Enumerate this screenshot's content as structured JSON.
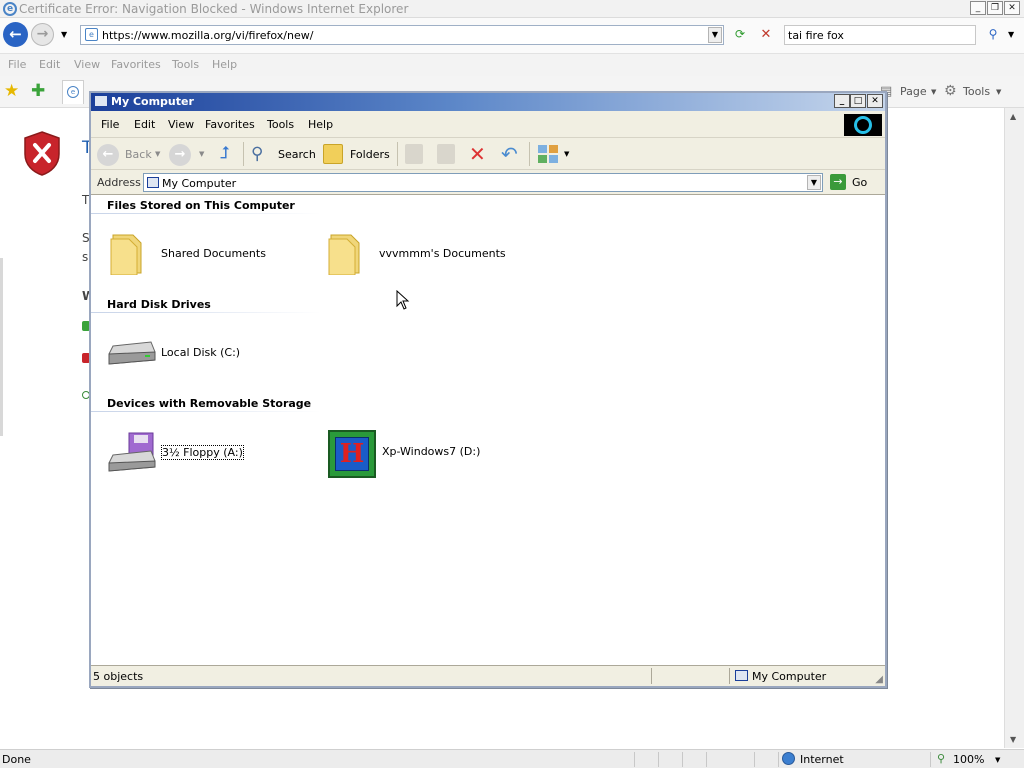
{
  "ie": {
    "title": "Certificate Error: Navigation Blocked - Windows Internet Explorer",
    "url": "https://www.mozilla.org/vi/firefox/new/",
    "search_value": "tai fire fox",
    "menu": [
      "File",
      "Edit",
      "View",
      "Favorites",
      "Tools",
      "Help"
    ],
    "cmd_page": "Page",
    "cmd_tools": "Tools",
    "page_fragments": [
      "T",
      "T",
      "S",
      "s",
      "W"
    ],
    "status": {
      "text": "Done",
      "zone": "Internet",
      "zoom": "100%"
    }
  },
  "mc": {
    "title": "My Computer",
    "menu": [
      "File",
      "Edit",
      "View",
      "Favorites",
      "Tools",
      "Help"
    ],
    "toolbar": {
      "back": "Back",
      "search": "Search",
      "folders": "Folders"
    },
    "address_label": "Address",
    "address_value": "My Computer",
    "go_label": "Go",
    "groups": [
      {
        "title": "Files Stored on This Computer",
        "items": [
          {
            "label": "Shared Documents",
            "icon": "folder-icon"
          },
          {
            "label": "vvvmmm's Documents",
            "icon": "folder-icon"
          }
        ]
      },
      {
        "title": "Hard Disk Drives",
        "items": [
          {
            "label": "Local Disk (C:)",
            "icon": "hard-disk-icon"
          }
        ]
      },
      {
        "title": "Devices with Removable Storage",
        "items": [
          {
            "label": "3½ Floppy (A:)",
            "icon": "floppy-drive-icon"
          },
          {
            "label": "Xp-Windows7 (D:)",
            "icon": "cd-drive-icon"
          }
        ]
      }
    ],
    "status": {
      "count": "5 objects",
      "location": "My Computer"
    }
  }
}
